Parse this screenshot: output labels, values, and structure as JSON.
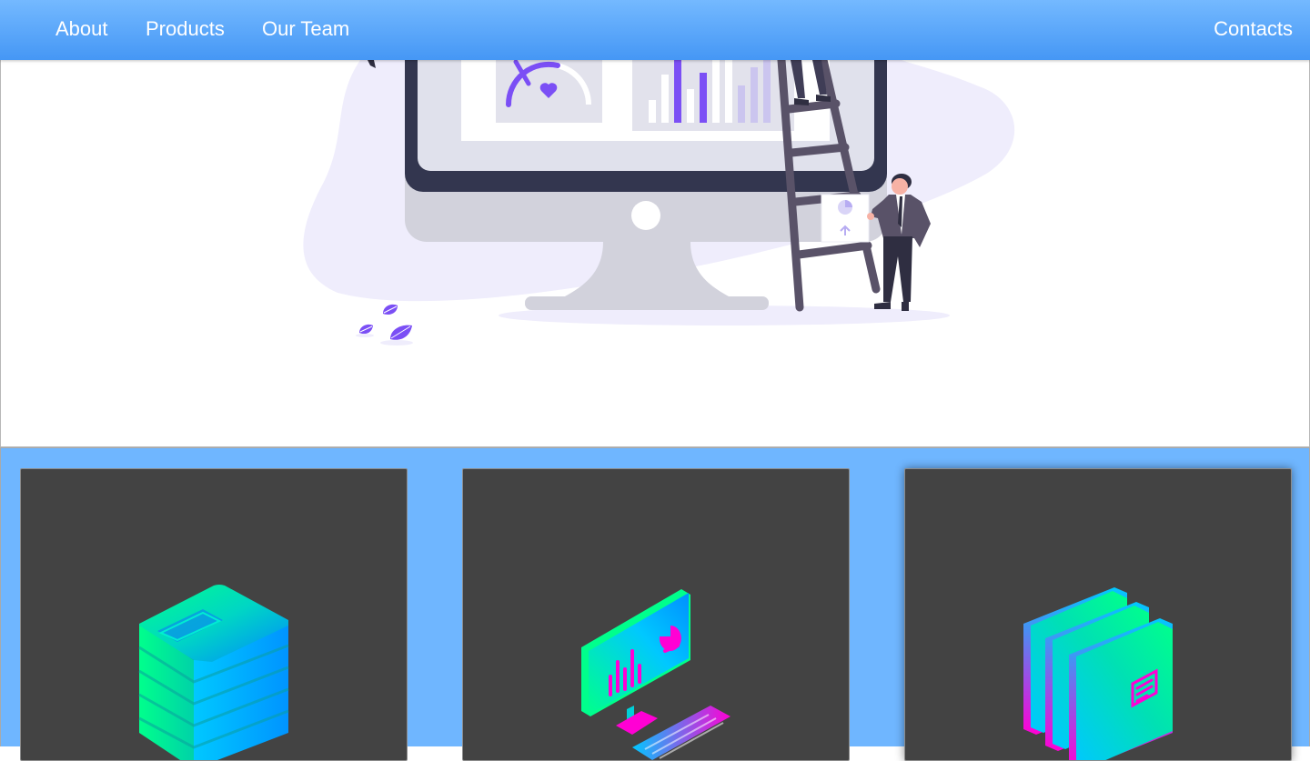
{
  "navbar": {
    "links": [
      "About",
      "Products",
      "Our Team"
    ],
    "contacts": "Contacts",
    "bg_colors": [
      "#74b9ff",
      "#4597f5"
    ]
  },
  "hero": {
    "illustration": "dashboard-analytics-illustration",
    "accent": "#7b4ff5"
  },
  "cards": [
    {
      "icon": "server-icon"
    },
    {
      "icon": "computer-analytics-icon"
    },
    {
      "icon": "folders-icon"
    }
  ],
  "colors": {
    "cards_bg": "#6fb6ff",
    "card_bg": "#434343",
    "gradient_cyan": "#00c8ff",
    "gradient_green": "#00ff8c",
    "gradient_magenta": "#ff00d4"
  }
}
